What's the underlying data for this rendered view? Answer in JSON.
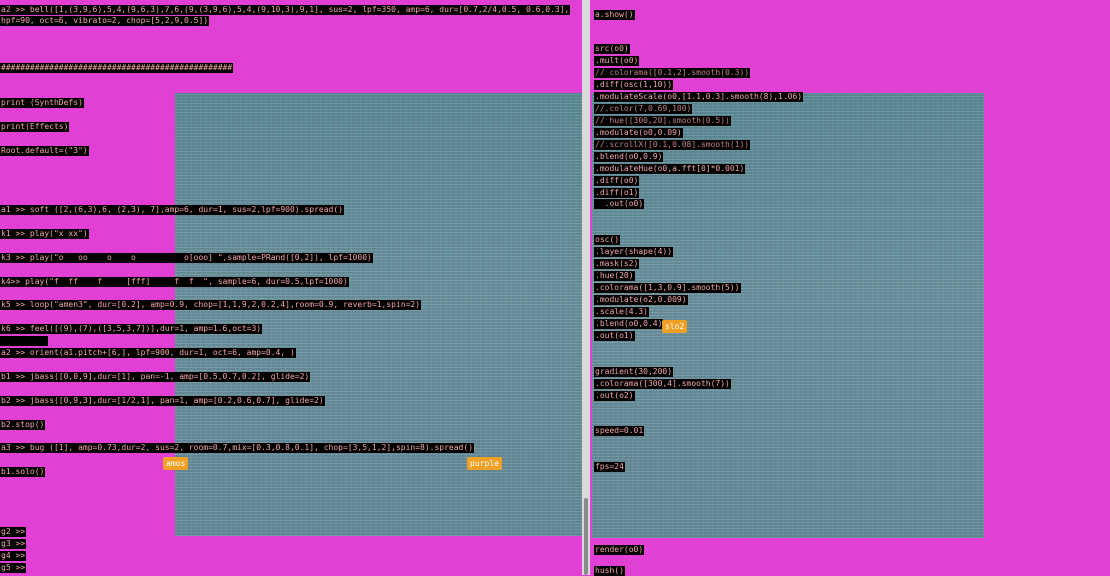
{
  "left_editor": {
    "lines": [
      "a2 >> bell([1,(3,9,6),5,4,(9,6,3),7,6,(9,(3,9,6),5,4,(9,10,3),9,1], sus=2, lpf=350, amp=6, dur=[0.7,2/4,0.5, 0.6,0.3],",
      "hpf=90, oct=6, vibrato=2, chop=[5,2,9,0.5])",
      "################################################",
      "print (SynthDefs)",
      "print(Effects)",
      "Root.default=(\"3\")",
      "a1 >> soft ([2,(6,3),6, (2,3), 7],amp=6, dur=1, sus=2,lpf=900).spread()",
      "k1 >> play(\"x xx\")",
      "k3 >> play(\"o   oo    o    o          o[ooo] \",sample=PRand([0,2]), lpf=1000)",
      "k4>> play(\"f  ff    f     [fff]     f  f  \", sample=6, dur=0.5,lpf=1000)",
      "k5 >> loop(\"amen3\", dur=[0.2], amp=0.9, chop=[1,1,9,2,0.2,4],room=0.9, reverb=1,spin=2)",
      "k6 >> feel([(9),(7),([3,5,3,7])],dur=1, amp=1.6,oct=3)",
      "a2 >> orient(a1.pitch+[6,], lpf=900, dur=1, oct=6, amp=0.4, )",
      "b1 >> jbass([0,0,9],dur=[1], pan=-1, amp=[0.5,0.7,0.2], glide=2)",
      "b2 >> jbass([0,9,3],dur=[1/2,1], pan=1, amp=[0.2,0.6,0.7], glide=2)",
      "b2.stop()",
      "a3 >> bug ([1], amp=0.73,dur=2, sus=2, room=0.7,mix=[0.3,0.8,0.1], chop=[3,5,1,2],spin=8).spread()",
      "b1.solo()",
      "g2 >>",
      "g3 >>",
      "g4 >>",
      "g5 >>"
    ],
    "badges": [
      "amos",
      "purple"
    ]
  },
  "right_editor": {
    "lines": [
      "a.show()",
      "src(o0)",
      ".mult(o0)",
      "// colorama([0.1,2].smooth(0.3))",
      ".diff(osc(1,10))",
      ".modulateScale(o0,[1.1,0.3].smooth(8),1.06)",
      "//.color(7,0.69,100)",
      "// hue([300,20].smooth(0.5))",
      ".modulate(o0,0.09)",
      "//.scrollX([0.1,0.08].smooth(1))",
      ".blend(o0,0.9)",
      ".modulateHue(o0,a.fft[0]*0.001)",
      ".diff(o0)",
      ".diff(o1)",
      "  .out(o0)",
      "osc()",
      ".layer(shape(4))",
      ".mask(s2)",
      ".hue(20)",
      ".colorama([1,3,0.9].smooth(5))",
      ".modulate(o2,0.009)",
      ".scale(4.3)",
      ".blend(o0,0.4)",
      ".out(o1)",
      "gradient(30,200)",
      ".colorama([300,4].smooth(7))",
      ".out(o2)",
      "speed=0.01",
      "fps=24",
      "render(o0)",
      "hush()"
    ],
    "badges": [
      "slo2"
    ]
  },
  "colors": {
    "background": "#e23fd4",
    "text": "#f3a7a7",
    "badge": "#f0a024"
  }
}
